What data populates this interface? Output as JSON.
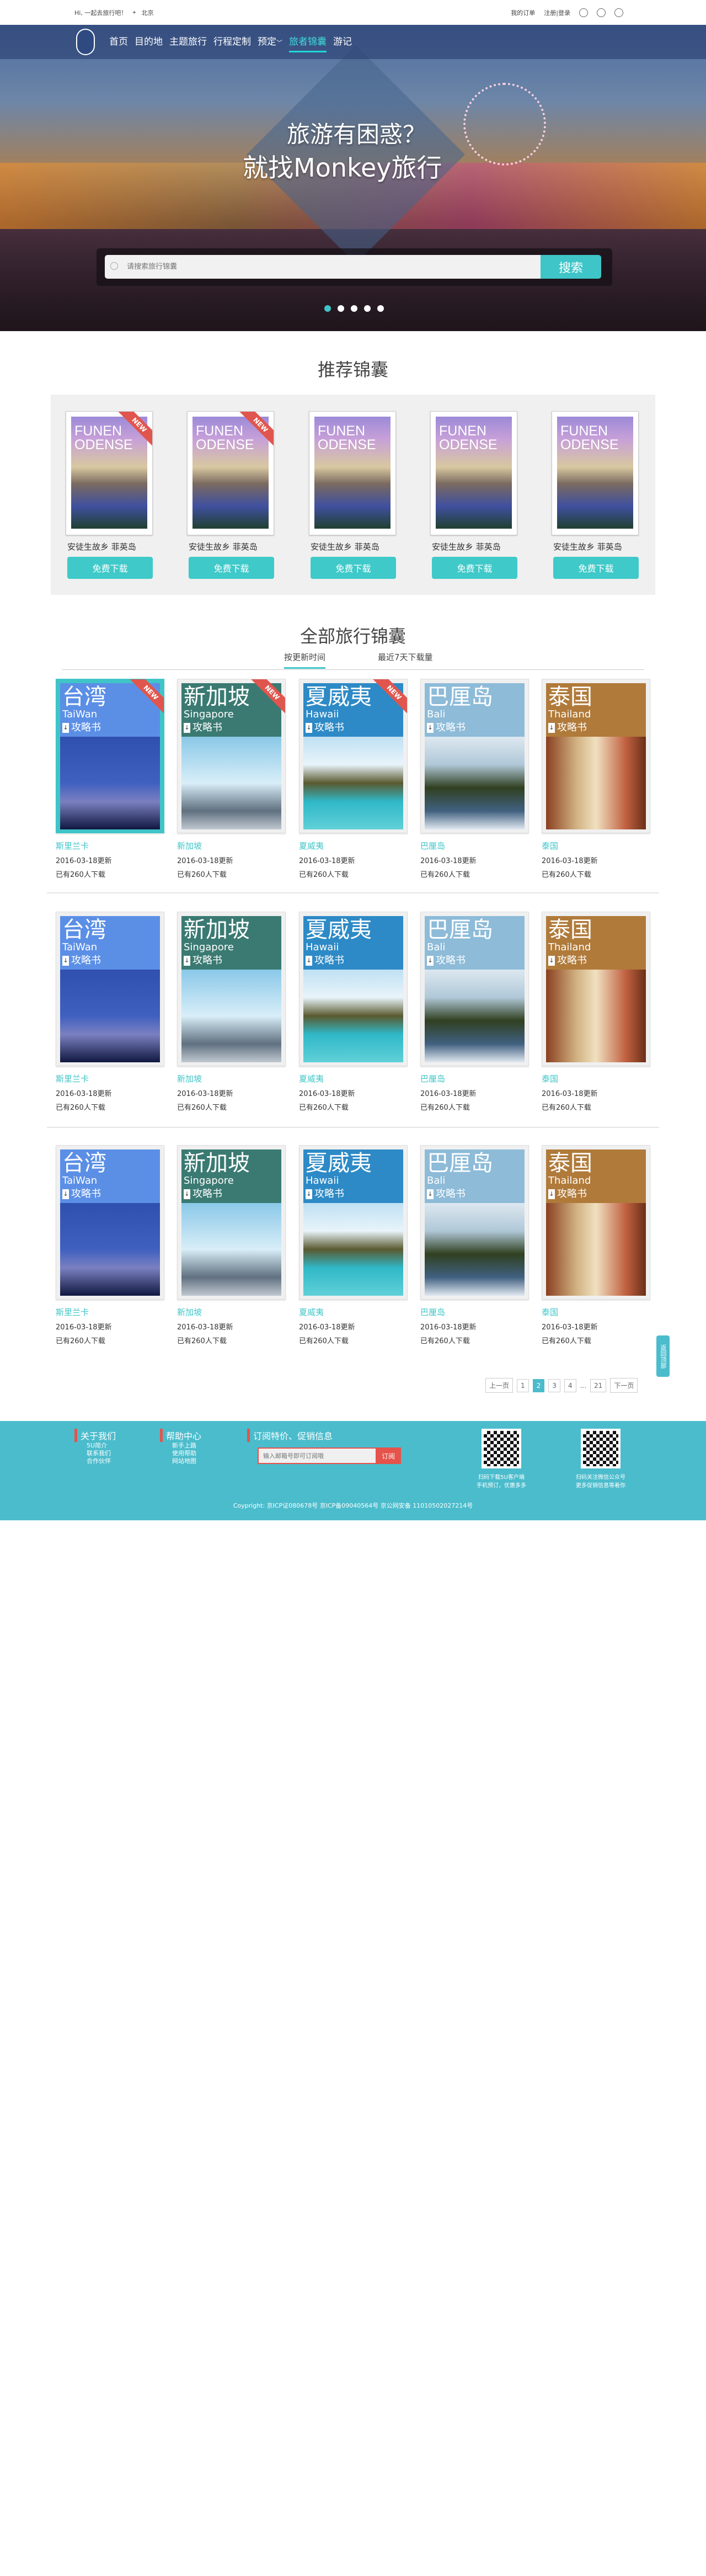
{
  "topbar": {
    "greeting": "Hi, 一起去旅行吧！",
    "location": "北京",
    "orders": "我的订单",
    "login": "注册|登录"
  },
  "nav": {
    "items": [
      "首页",
      "目的地",
      "主题旅行",
      "行程定制",
      "预定",
      "旅者锦囊",
      "游记"
    ],
    "active": "旅者锦囊"
  },
  "hero": {
    "line1": "旅游有困惑？",
    "line2": "就找Monkey旅行",
    "search_placeholder": "请搜索旅行锦囊",
    "search_button": "搜索",
    "slide_count": 5,
    "active_slide": 1
  },
  "recommended": {
    "title": "推荐锦囊",
    "cover_line1": "FUNEN",
    "cover_line2": "ODENSE",
    "new_label": "NEW",
    "items": [
      {
        "name": "安徒生故乡 菲英岛",
        "button": "免费下载",
        "new": true
      },
      {
        "name": "安徒生故乡 菲英岛",
        "button": "免费下载",
        "new": true
      },
      {
        "name": "安徒生故乡 菲英岛",
        "button": "免费下载",
        "new": false
      },
      {
        "name": "安徒生故乡 菲英岛",
        "button": "免费下载",
        "new": false
      },
      {
        "name": "安徒生故乡 菲英岛",
        "button": "免费下载",
        "new": false
      }
    ]
  },
  "all": {
    "title": "全部旅行锦囊",
    "tabs": [
      "按更新时间",
      "最近7天下载量"
    ],
    "guide_label": "攻略书",
    "covers": [
      {
        "cn": "台湾",
        "en": "TaiWan",
        "color": "#5b8fe6"
      },
      {
        "cn": "新加坡",
        "en": "Singapore",
        "color": "#3a7a72"
      },
      {
        "cn": "夏威夷",
        "en": "Hawaii",
        "color": "#2d8ac6"
      },
      {
        "cn": "巴厘岛",
        "en": "Bali",
        "color": "#8dbbd8"
      },
      {
        "cn": "泰国",
        "en": "Thailand",
        "color": "#b07a3a"
      }
    ],
    "names": [
      "斯里兰卡",
      "新加坡",
      "夏威夷",
      "巴厘岛",
      "泰国"
    ],
    "date": "2016-03-18更新",
    "downloads": "已有260人下载"
  },
  "pagination": {
    "prev": "上一页",
    "pages": [
      "1",
      "2",
      "3",
      "4",
      "...",
      "21"
    ],
    "current": "2",
    "next": "下一页"
  },
  "back_to_top": "返回顶部",
  "footer": {
    "about": {
      "title": "关于我们",
      "links": [
        "5U简介",
        "联系我们",
        "合作伙伴"
      ]
    },
    "help": {
      "title": "帮助中心",
      "links": [
        "新手上路",
        "使用帮助",
        "网站地图"
      ]
    },
    "subscribe": {
      "title": "订阅特价、促销信息",
      "placeholder": "输入邮箱号即可订阅哦",
      "button": "订阅"
    },
    "qr1": [
      "扫码下载5U客户端",
      "手机预订，优惠多多"
    ],
    "qr2": [
      "扫码关注微信公众号",
      "更多促销信息等着你"
    ],
    "copyright": "Coypright: 京ICP证080678号 京ICP备09040564号 京公网安备 11010502027214号"
  }
}
